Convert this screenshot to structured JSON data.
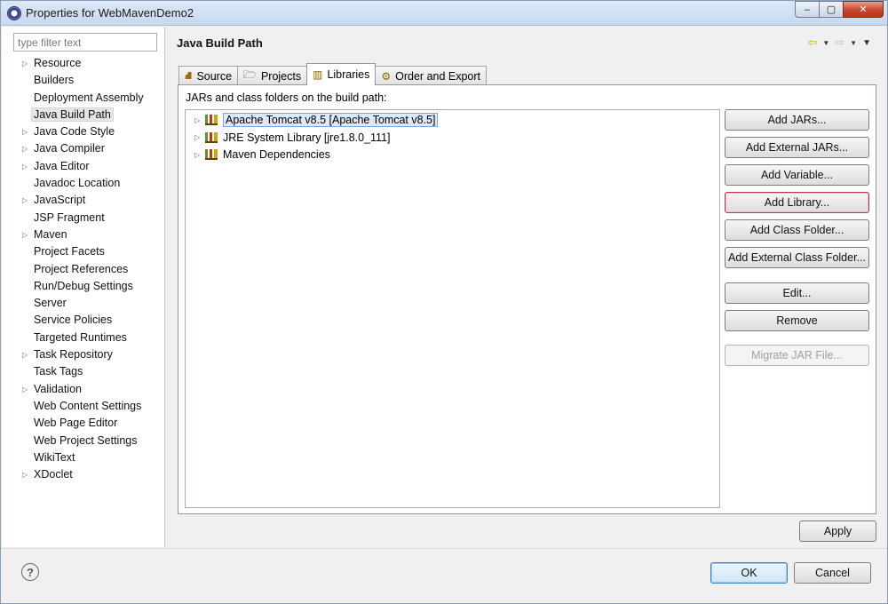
{
  "window": {
    "title": "Properties for WebMavenDemo2",
    "minimize": "–",
    "maximize": "▢",
    "close": "✕"
  },
  "filter": {
    "placeholder": "type filter text",
    "value": ""
  },
  "nav": {
    "items": [
      {
        "label": "Resource",
        "expandable": true
      },
      {
        "label": "Builders",
        "expandable": false
      },
      {
        "label": "Deployment Assembly",
        "expandable": false
      },
      {
        "label": "Java Build Path",
        "expandable": false,
        "selected": true
      },
      {
        "label": "Java Code Style",
        "expandable": true
      },
      {
        "label": "Java Compiler",
        "expandable": true
      },
      {
        "label": "Java Editor",
        "expandable": true
      },
      {
        "label": "Javadoc Location",
        "expandable": false
      },
      {
        "label": "JavaScript",
        "expandable": true
      },
      {
        "label": "JSP Fragment",
        "expandable": false
      },
      {
        "label": "Maven",
        "expandable": true
      },
      {
        "label": "Project Facets",
        "expandable": false
      },
      {
        "label": "Project References",
        "expandable": false
      },
      {
        "label": "Run/Debug Settings",
        "expandable": false
      },
      {
        "label": "Server",
        "expandable": false
      },
      {
        "label": "Service Policies",
        "expandable": false
      },
      {
        "label": "Targeted Runtimes",
        "expandable": false
      },
      {
        "label": "Task Repository",
        "expandable": true
      },
      {
        "label": "Task Tags",
        "expandable": false
      },
      {
        "label": "Validation",
        "expandable": true
      },
      {
        "label": "Web Content Settings",
        "expandable": false
      },
      {
        "label": "Web Page Editor",
        "expandable": false
      },
      {
        "label": "Web Project Settings",
        "expandable": false
      },
      {
        "label": "WikiText",
        "expandable": false
      },
      {
        "label": "XDoclet",
        "expandable": true
      }
    ]
  },
  "pane": {
    "title": "Java Build Path"
  },
  "tabs": [
    {
      "label": "Source",
      "icon": "source-folder-icon"
    },
    {
      "label": "Projects",
      "icon": "projects-folder-icon"
    },
    {
      "label": "Libraries",
      "icon": "libraries-icon",
      "active": true
    },
    {
      "label": "Order and Export",
      "icon": "order-export-icon"
    }
  ],
  "libraries": {
    "label": "JARs and class folders on the build path:",
    "entries": [
      {
        "label": "Apache Tomcat v8.5 [Apache Tomcat v8.5]",
        "selected": true
      },
      {
        "label": "JRE System Library [jre1.8.0_111]"
      },
      {
        "label": "Maven Dependencies"
      }
    ]
  },
  "buttons": {
    "add_jars": "Add JARs...",
    "add_external_jars": "Add External JARs...",
    "add_variable": "Add Variable...",
    "add_library": "Add Library...",
    "add_class_folder": "Add Class Folder...",
    "add_external_class_folder": "Add External Class Folder...",
    "edit": "Edit...",
    "remove": "Remove",
    "migrate_jar": "Migrate JAR File...",
    "apply": "Apply",
    "ok": "OK",
    "cancel": "Cancel"
  },
  "help": {
    "glyph": "?"
  }
}
